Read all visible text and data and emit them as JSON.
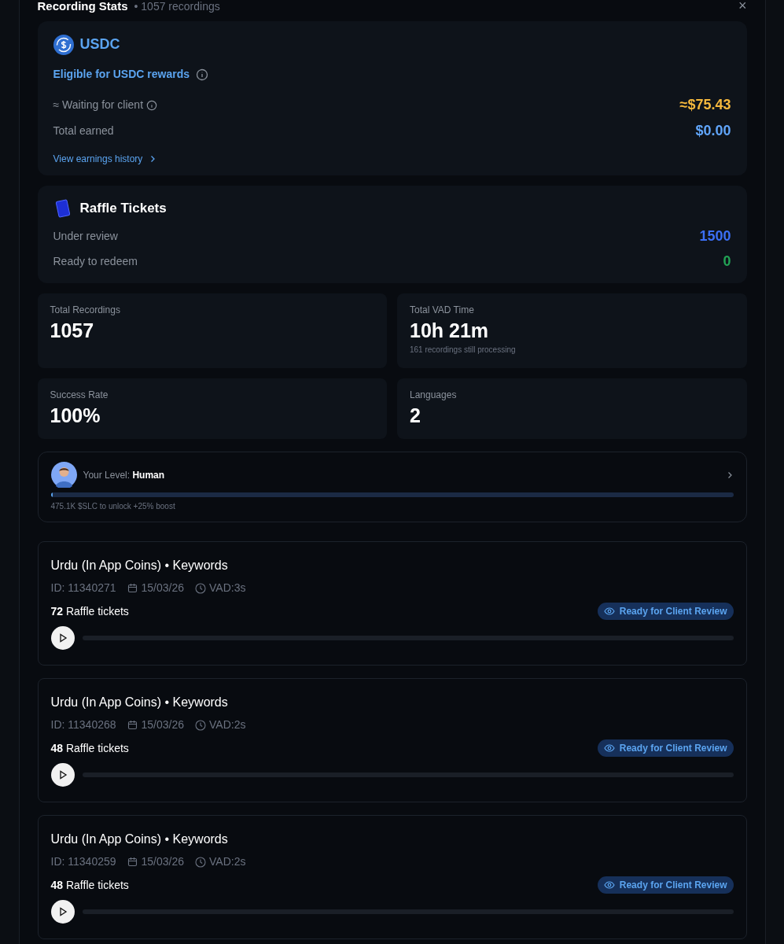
{
  "header": {
    "title": "Recording Stats",
    "subtitle": "• 1057 recordings",
    "close": "×"
  },
  "usdc": {
    "title": "USDC",
    "eligibility": "Eligible for USDC rewards",
    "rows": [
      {
        "label": "≈ Waiting for client",
        "info": true,
        "value": "≈$75.43",
        "color": "#f5b83d"
      },
      {
        "label": "Total earned",
        "info": false,
        "value": "$0.00",
        "color": "#60a5fa"
      }
    ],
    "link": "View earnings history"
  },
  "raffle": {
    "title": "Raffle Tickets",
    "rows": [
      {
        "label": "Under review",
        "value": "1500",
        "color": "#3b6ff5"
      },
      {
        "label": "Ready to redeem",
        "value": "0",
        "color": "#22a355"
      }
    ]
  },
  "stats": [
    {
      "label": "Total Recordings",
      "value": "1057"
    },
    {
      "label": "Total VAD Time",
      "value": "10h 21m",
      "note": "161 recordings still processing"
    },
    {
      "label": "Success Rate",
      "value": "100%"
    },
    {
      "label": "Languages",
      "value": "2"
    }
  ],
  "level": {
    "label": "Your Level:",
    "name": "Human",
    "level": 0.003,
    "hint": "475.1K $SLC to unlock +25% boost"
  },
  "recordings": [
    {
      "title": "Urdu (In App Coins) • Keywords",
      "id": "ID: 11340271",
      "date": "15/03/26",
      "vad": "VAD:3s",
      "tickets": "72",
      "tickets_label": "Raffle tickets",
      "status": "Ready for Client Review"
    },
    {
      "title": "Urdu (In App Coins) • Keywords",
      "id": "ID: 11340268",
      "date": "15/03/26",
      "vad": "VAD:2s",
      "tickets": "48",
      "tickets_label": "Raffle tickets",
      "status": "Ready for Client Review"
    },
    {
      "title": "Urdu (In App Coins) • Keywords",
      "id": "ID: 11340259",
      "date": "15/03/26",
      "vad": "VAD:2s",
      "tickets": "48",
      "tickets_label": "Raffle tickets",
      "status": "Ready for Client Review"
    }
  ]
}
